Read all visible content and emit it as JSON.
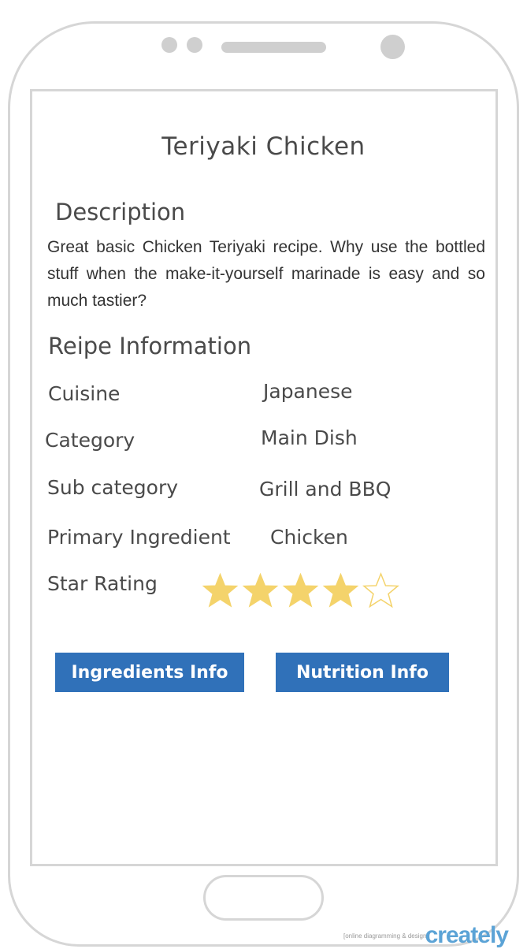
{
  "recipe": {
    "title": "Teriyaki Chicken",
    "description_heading": "Description",
    "description": "Great basic Chicken Teriyaki recipe. Why use the bottled stuff when the make-it-yourself marinade is easy and so much tastier?",
    "info_heading": "Reipe Information",
    "fields": {
      "cuisine_label": "Cuisine",
      "cuisine_value": "Japanese",
      "category_label": "Category",
      "category_value": "Main Dish",
      "subcategory_label": "Sub category",
      "subcategory_value": "Grill and BBQ",
      "ingredient_label": "Primary Ingredient",
      "ingredient_value": "Chicken",
      "rating_label": "Star Rating"
    },
    "rating": {
      "value": 4,
      "max": 5
    }
  },
  "buttons": {
    "ingredients": "Ingredients Info",
    "nutrition": "Nutrition Info"
  },
  "colors": {
    "button_bg": "#3071b9",
    "star_filled": "#f4d36b",
    "star_empty_outline": "#f4d36b",
    "frame": "#d6d6d6"
  },
  "watermark": {
    "brand": "creately",
    "tagline": "[online diagramming & design]"
  }
}
